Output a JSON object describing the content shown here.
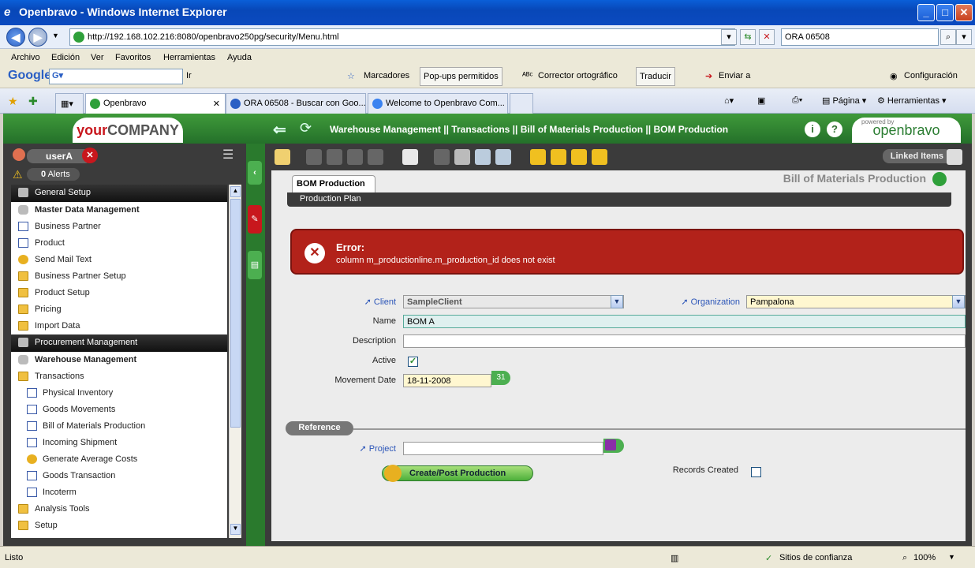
{
  "window": {
    "title": "Openbravo - Windows Internet Explorer"
  },
  "address": {
    "url": "http://192.168.102.216:8080/openbravo250pg/security/Menu.html",
    "search": "ORA 06508"
  },
  "menubar": [
    "Archivo",
    "Edición",
    "Ver",
    "Favoritos",
    "Herramientas",
    "Ayuda"
  ],
  "googlebar": {
    "brand": "Google",
    "go": "Ir",
    "bookmarks": "Marcadores",
    "popups": "Pop-ups permitidos",
    "spell": "Corrector ortográfico",
    "translate": "Traducir",
    "send": "Enviar a",
    "config": "Configuración"
  },
  "tabs": [
    {
      "label": "Openbravo"
    },
    {
      "label": "ORA 06508 - Buscar con Goo..."
    },
    {
      "label": "Welcome to Openbravo Com..."
    }
  ],
  "ietools": {
    "page": "Página",
    "tools": "Herramientas"
  },
  "app": {
    "logo_bold": "your",
    "logo_rest": "COMPANY",
    "breadcrumb": "Warehouse Management  ||  Transactions  ||  Bill of Materials Production   ||  BOM Production",
    "powered_small": "powered by",
    "powered_brand": "openbravo"
  },
  "user": {
    "name": "userA",
    "alerts_count": "0",
    "alerts_label": "Alerts"
  },
  "menu": [
    {
      "text": "General Setup",
      "kind": "head"
    },
    {
      "text": "Master Data Management",
      "kind": "sub",
      "icon": "db"
    },
    {
      "text": "Business Partner",
      "kind": "item",
      "icon": "win"
    },
    {
      "text": "Product",
      "kind": "item",
      "icon": "win"
    },
    {
      "text": "Send Mail Text",
      "kind": "item",
      "icon": "gear"
    },
    {
      "text": "Business Partner Setup",
      "kind": "item",
      "icon": "folder"
    },
    {
      "text": "Product Setup",
      "kind": "item",
      "icon": "folder"
    },
    {
      "text": "Pricing",
      "kind": "item",
      "icon": "folder"
    },
    {
      "text": "Import Data",
      "kind": "item",
      "icon": "folder"
    },
    {
      "text": "Procurement Management",
      "kind": "head"
    },
    {
      "text": "Warehouse Management",
      "kind": "sub",
      "icon": "db"
    },
    {
      "text": "Transactions",
      "kind": "item",
      "icon": "folder"
    },
    {
      "text": "Physical Inventory",
      "kind": "l2",
      "icon": "win"
    },
    {
      "text": "Goods Movements",
      "kind": "l2",
      "icon": "win"
    },
    {
      "text": "Bill of Materials Production",
      "kind": "l2",
      "icon": "win"
    },
    {
      "text": "Incoming Shipment",
      "kind": "l2",
      "icon": "win"
    },
    {
      "text": "Generate Average Costs",
      "kind": "l2",
      "icon": "gear"
    },
    {
      "text": "Goods Transaction",
      "kind": "l2",
      "icon": "win"
    },
    {
      "text": "Incoterm",
      "kind": "l2",
      "icon": "win"
    },
    {
      "text": "Analysis Tools",
      "kind": "item",
      "icon": "folder"
    },
    {
      "text": "Setup",
      "kind": "item",
      "icon": "folder"
    }
  ],
  "window_content": {
    "linked_items": "Linked Items",
    "window_title": "Bill of Materials Production",
    "tab": "BOM Production",
    "subtab": "Production Plan",
    "error_title": "Error:",
    "error_message": "column m_productionline.m_production_id does not exist",
    "form": {
      "client_label": "Client",
      "client_value": "SampleClient",
      "org_label": "Organization",
      "org_value": "Pampalona",
      "name_label": "Name",
      "name_value": "BOM A",
      "description_label": "Description",
      "description_value": "",
      "active_label": "Active",
      "active_checked": true,
      "date_label": "Movement Date",
      "date_value": "18-11-2008",
      "reference_section": "Reference",
      "project_label": "Project",
      "project_value": "",
      "create_button": "Create/Post Production",
      "records_label": "Records Created",
      "records_checked": false
    }
  },
  "status": {
    "left": "Listo",
    "zone": "Sitios de confianza",
    "zoom": "100%"
  }
}
